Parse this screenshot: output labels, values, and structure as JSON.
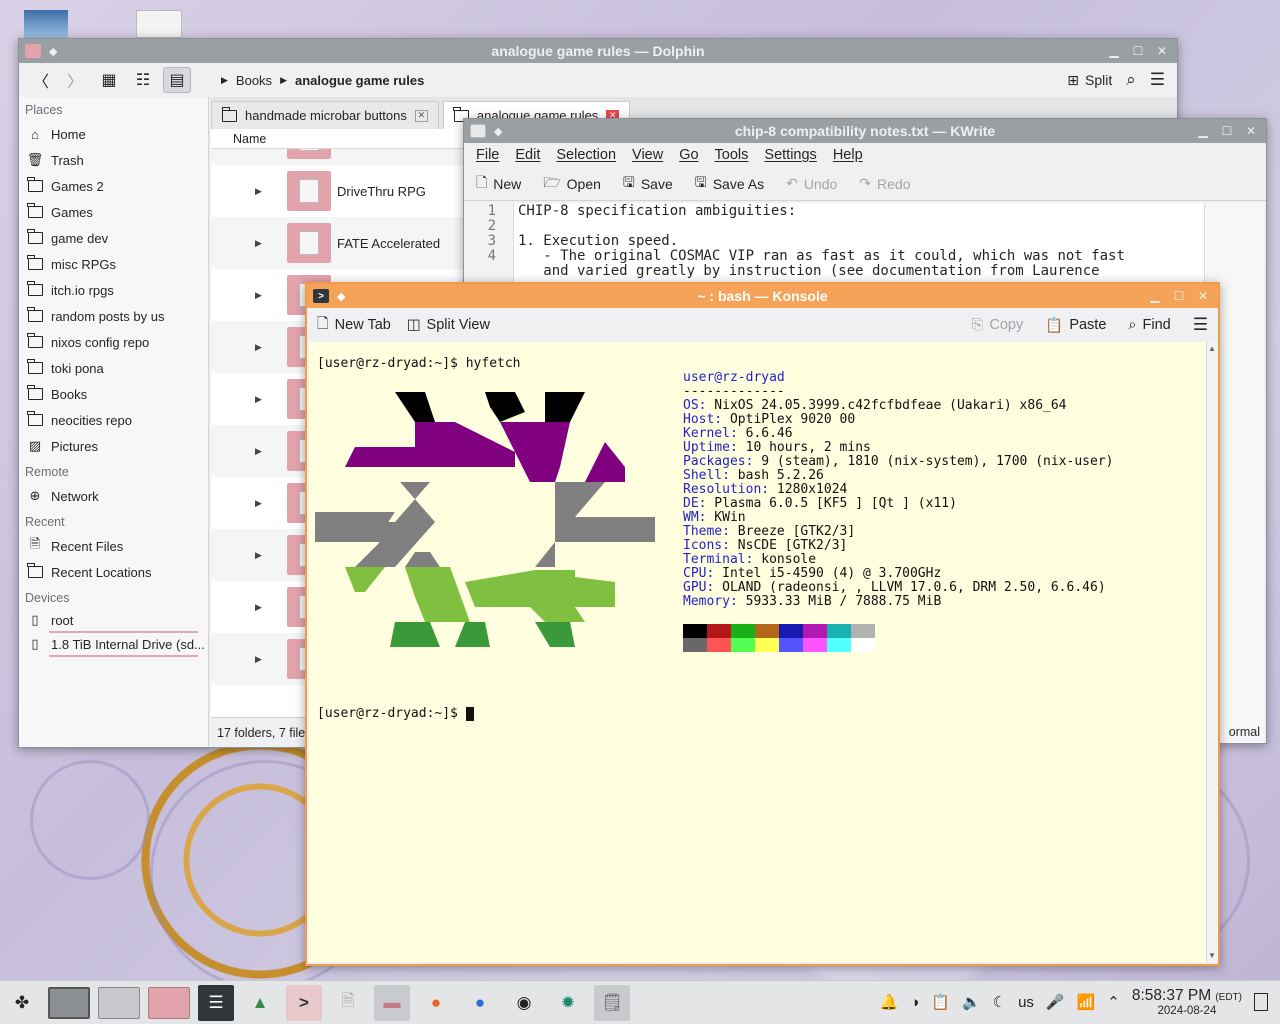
{
  "dolphin": {
    "title": "analogue game rules — Dolphin",
    "breadcrumb": {
      "parent": "Books",
      "current": "analogue game rules"
    },
    "split_label": "Split",
    "places_head": "Places",
    "places": [
      "Home",
      "Trash",
      "Games 2",
      "Games",
      "game dev",
      "misc RPGs",
      "itch.io rpgs",
      "random posts by us",
      "nixos config repo",
      "toki pona",
      "Books",
      "neocities repo",
      "Pictures"
    ],
    "remote_head": "Remote",
    "remote": [
      "Network"
    ],
    "recent_head": "Recent",
    "recent": [
      "Recent Files",
      "Recent Locations"
    ],
    "devices_head": "Devices",
    "devices": [
      "root",
      "1.8 TiB Internal Drive (sd..."
    ],
    "tabs": [
      "handmade microbar buttons",
      "analogue game rules"
    ],
    "column_name": "Name",
    "files": [
      "DriveThru RPG",
      "FATE Accelerated"
    ],
    "status": "17 folders, 7 file"
  },
  "kwrite": {
    "title": "chip-8 compatibility notes.txt — KWrite",
    "menu": [
      "File",
      "Edit",
      "Selection",
      "View",
      "Go",
      "Tools",
      "Settings",
      "Help"
    ],
    "toolbar": {
      "new": "New",
      "open": "Open",
      "save": "Save",
      "save_as": "Save As",
      "undo": "Undo",
      "redo": "Redo"
    },
    "line_numbers": [
      "1",
      "2",
      "3",
      "4"
    ],
    "lines": [
      "CHIP-8 specification ambiguities:",
      "",
      "1. Execution speed.",
      "   - The original COSMAC VIP ran as fast as it could, which was not fast",
      "   and varied greatly by instruction (see documentation from Laurence"
    ],
    "status_mode": "ormal"
  },
  "konsole": {
    "title": "~ : bash — Konsole",
    "toolbar": {
      "new_tab": "New Tab",
      "split_view": "Split View",
      "copy": "Copy",
      "paste": "Paste",
      "find": "Find"
    },
    "prompt1": "[user@rz-dryad:~]$ ",
    "command": "hyfetch",
    "prompt2": "[user@rz-dryad:~]$ ",
    "user_host": "user@rz-dryad",
    "separator": "-------------",
    "info": [
      {
        "key": "OS",
        "value": " NixOS 24.05.3999.c42fcfbdfeae (Uakari) x86_64"
      },
      {
        "key": "Host",
        "value": " OptiPlex 9020 00"
      },
      {
        "key": "Kernel",
        "value": " 6.6.46"
      },
      {
        "key": "Uptime",
        "value": " 10 hours, 2 mins"
      },
      {
        "key": "Packages",
        "value": " 9 (steam), 1810 (nix-system), 1700 (nix-user)"
      },
      {
        "key": "Shell",
        "value": " bash 5.2.26"
      },
      {
        "key": "Resolution",
        "value": " 1280x1024"
      },
      {
        "key": "DE",
        "value": " Plasma 6.0.5 [KF5 ] [Qt ] (x11)"
      },
      {
        "key": "WM",
        "value": " KWin"
      },
      {
        "key": "Theme",
        "value": " Breeze [GTK2/3]"
      },
      {
        "key": "Icons",
        "value": " NsCDE [GTK2/3]"
      },
      {
        "key": "Terminal",
        "value": " konsole"
      },
      {
        "key": "CPU",
        "value": " Intel i5-4590 (4) @ 3.700GHz"
      },
      {
        "key": "GPU",
        "value": " OLAND (radeonsi, , LLVM 17.0.6, DRM 2.50, 6.6.46)"
      },
      {
        "key": "Memory",
        "value": " 5933.33 MiB / 7888.75 MiB"
      }
    ],
    "palette_top": [
      "#000000",
      "#b21818",
      "#18b218",
      "#b26818",
      "#1818b2",
      "#b218b2",
      "#18b2b2",
      "#b2b2b2"
    ],
    "palette_bottom": [
      "#686868",
      "#ff5454",
      "#54ff54",
      "#ffff54",
      "#5454ff",
      "#ff54ff",
      "#54ffff",
      "#ffffff"
    ],
    "logo_colors": {
      "black": "#000000",
      "purple": "#800080",
      "gray": "#808080",
      "green": "#80c040",
      "dark_green": "#3a9a3a"
    }
  },
  "taskbar": {
    "lang": "us",
    "time": "8:58:37 PM",
    "tz": "(EDT)",
    "date": "2024-08-24"
  }
}
